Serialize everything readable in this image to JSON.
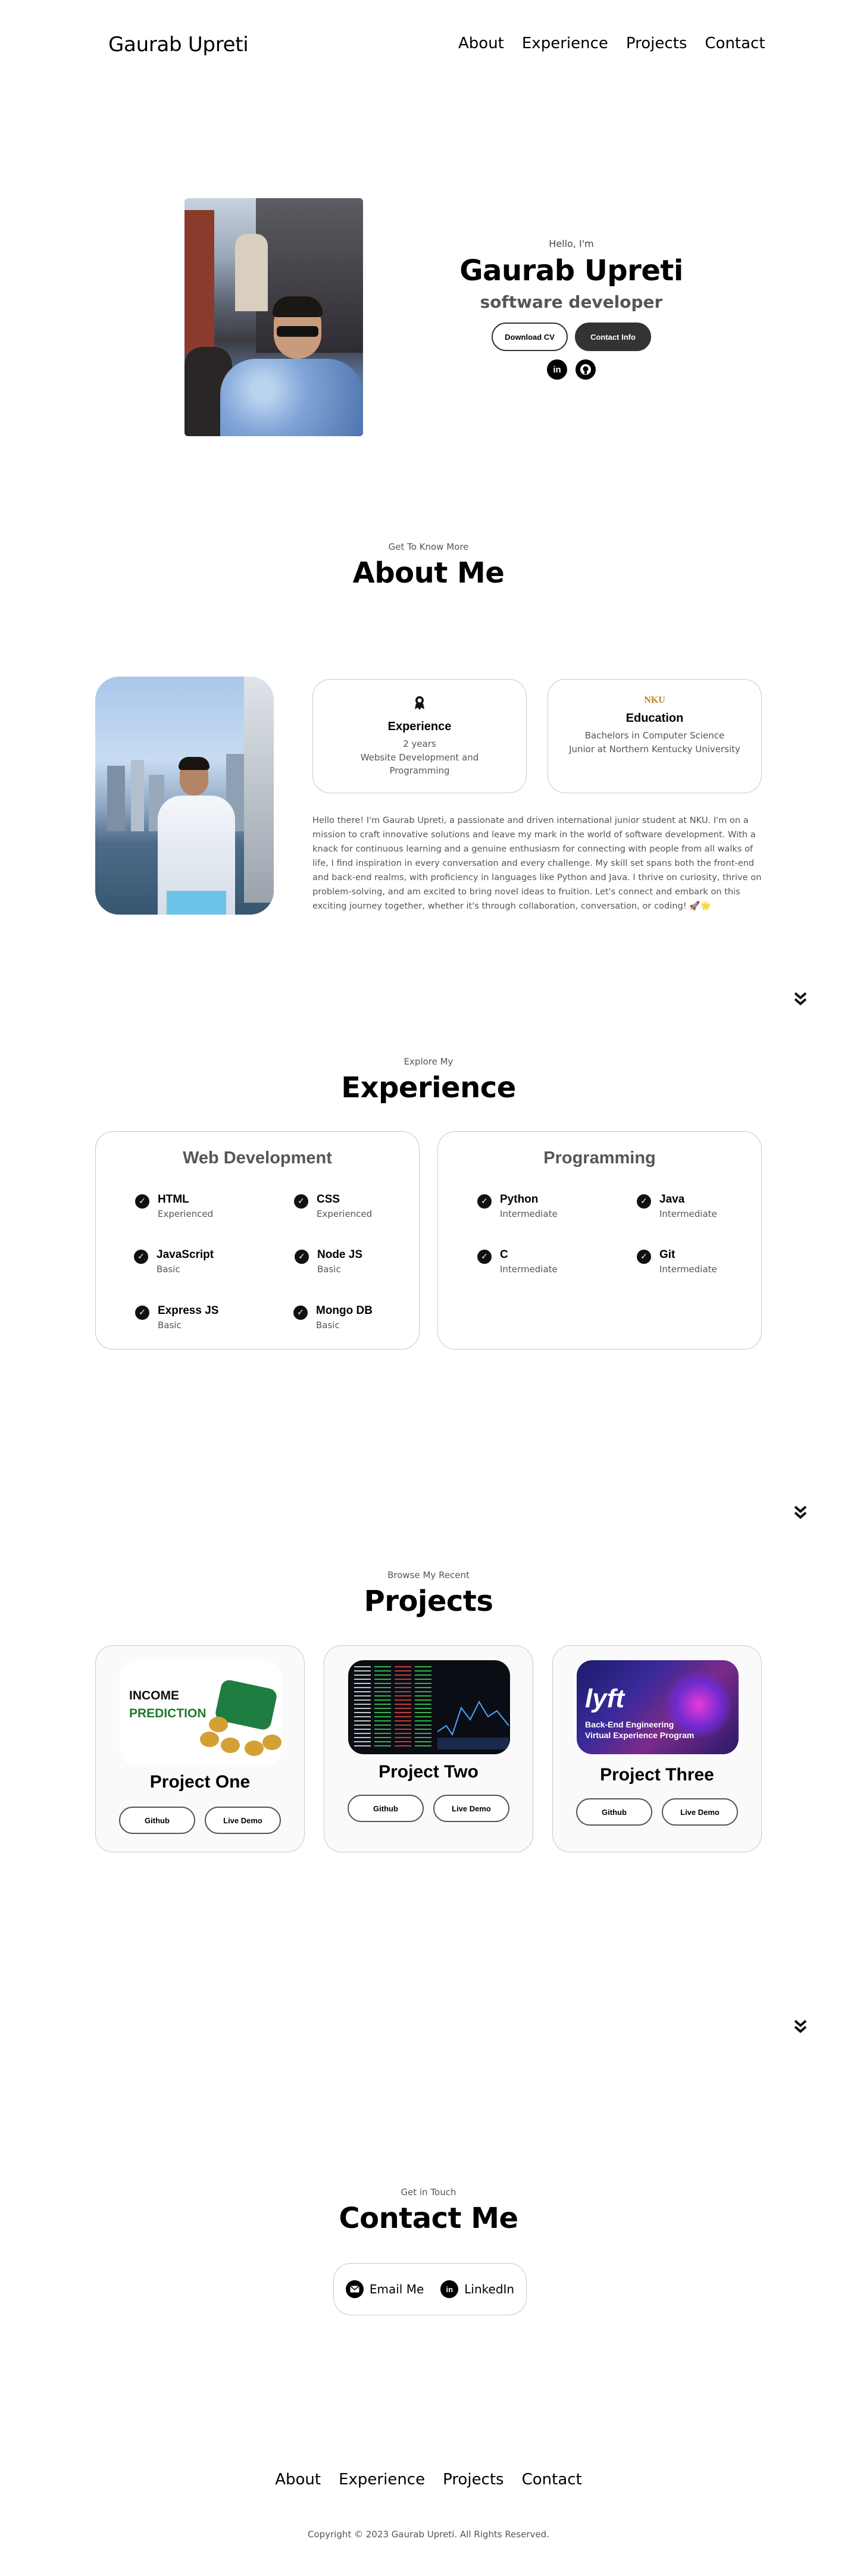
{
  "nav": {
    "logo": "Gaurab Upreti",
    "links": [
      "About",
      "Experience",
      "Projects",
      "Contact"
    ]
  },
  "hero": {
    "greeting": "Hello, I'm",
    "name": "Gaurab Upreti",
    "role": "software developer",
    "download_cv": "Download CV",
    "contact_info": "Contact Info",
    "icons": [
      "linkedin-icon",
      "github-icon"
    ]
  },
  "about": {
    "subtitle": "Get To Know More",
    "title": "About Me",
    "experience_card": {
      "icon": "award-icon",
      "title": "Experience",
      "line1": "2 years",
      "line2": "Website Development and Programming"
    },
    "education_card": {
      "icon": "nku-logo-icon",
      "logo_text": "NKU",
      "title": "Education",
      "line1": "Bachelors in Computer Science",
      "line2": "Junior at Northern Kentucky University"
    },
    "bio": "Hello there! I'm Gaurab Upreti, a passionate and driven international junior student at NKU. I'm on a mission to craft innovative solutions and leave my mark in the world of software development. With a knack for continuous learning and a genuine enthusiasm for connecting with people from all walks of life, I find inspiration in every conversation and every challenge. My skill set spans both the front-end and back-end realms, with proficiency in languages like Python and Java. I thrive on curiosity, thrive on problem-solving, and am excited to bring novel ideas to fruition. Let's connect and embark on this exciting journey together, whether it's through collaboration, conversation, or coding! 🚀🌟"
  },
  "experience": {
    "subtitle": "Explore My",
    "title": "Experience",
    "web": {
      "title": "Web Development",
      "skills": [
        {
          "name": "HTML",
          "level": "Experienced"
        },
        {
          "name": "CSS",
          "level": "Experienced"
        },
        {
          "name": "JavaScript",
          "level": "Basic"
        },
        {
          "name": "Node JS",
          "level": "Basic"
        },
        {
          "name": "Express JS",
          "level": "Basic"
        },
        {
          "name": "Mongo DB",
          "level": "Basic"
        }
      ]
    },
    "programming": {
      "title": "Programming",
      "skills": [
        {
          "name": "Python",
          "level": "Intermediate"
        },
        {
          "name": "Java",
          "level": "Intermediate"
        },
        {
          "name": "C",
          "level": "Intermediate"
        },
        {
          "name": "Git",
          "level": "Intermediate"
        }
      ]
    }
  },
  "projects": {
    "subtitle": "Browse My Recent",
    "title": "Projects",
    "items": [
      {
        "name": "Project One",
        "github": "Github",
        "demo": "Live Demo",
        "img_text1": "INCOME",
        "img_text2": "PREDICTION"
      },
      {
        "name": "Project Two",
        "github": "Github",
        "demo": "Live Demo"
      },
      {
        "name": "Project Three",
        "github": "Github",
        "demo": "Live Demo",
        "img_logo": "lyft",
        "img_text1": "Back-End Engineering",
        "img_text2": "Virtual Experience Program"
      }
    ]
  },
  "contact": {
    "subtitle": "Get in Touch",
    "title": "Contact Me",
    "email": "Email Me",
    "linkedin": "LinkedIn"
  },
  "footer": {
    "links": [
      "About",
      "Experience",
      "Projects",
      "Contact"
    ],
    "copyright": "Copyright © 2023 Gaurab Upreti. All Rights Reserved."
  },
  "colors": {
    "accent_dark": "#333333",
    "text_muted": "#555555",
    "border": "#c8c8c8"
  }
}
